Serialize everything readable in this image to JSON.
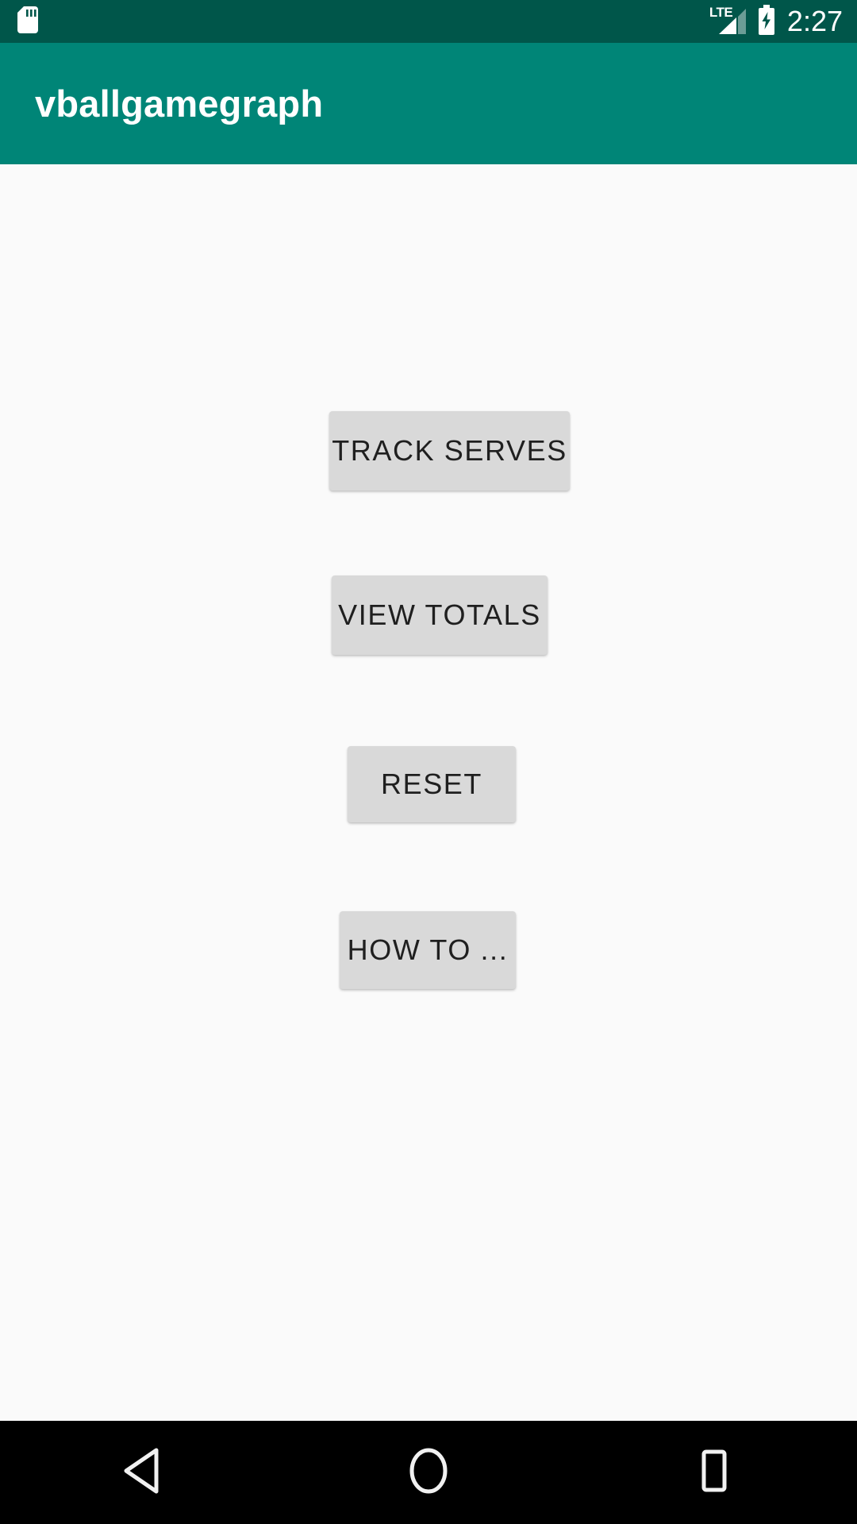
{
  "status_bar": {
    "sd_card_icon": "sd-card-icon",
    "network_label": "LTE",
    "signal_icon": "signal-bars-icon",
    "battery_icon": "battery-charging-icon",
    "time": "2:27",
    "background_color": "#00564a",
    "foreground_color": "#ffffff"
  },
  "app_bar": {
    "title": "vballgamegraph",
    "background_color": "#008577",
    "title_color": "#ffffff"
  },
  "main": {
    "background_color": "#fafafa",
    "buttons": [
      {
        "id": "track-serves",
        "label": "TRACK SERVES"
      },
      {
        "id": "view-totals",
        "label": "VIEW TOTALS"
      },
      {
        "id": "reset",
        "label": "RESET"
      },
      {
        "id": "how-to",
        "label": "HOW TO ..."
      }
    ],
    "button_background_color": "#d9d9d9",
    "button_text_color": "#1f1f1f"
  },
  "navigation_bar": {
    "background_color": "#000000",
    "items": [
      {
        "id": "back",
        "icon": "back-triangle-icon"
      },
      {
        "id": "home",
        "icon": "home-circle-icon"
      },
      {
        "id": "recents",
        "icon": "recents-square-icon"
      }
    ]
  }
}
